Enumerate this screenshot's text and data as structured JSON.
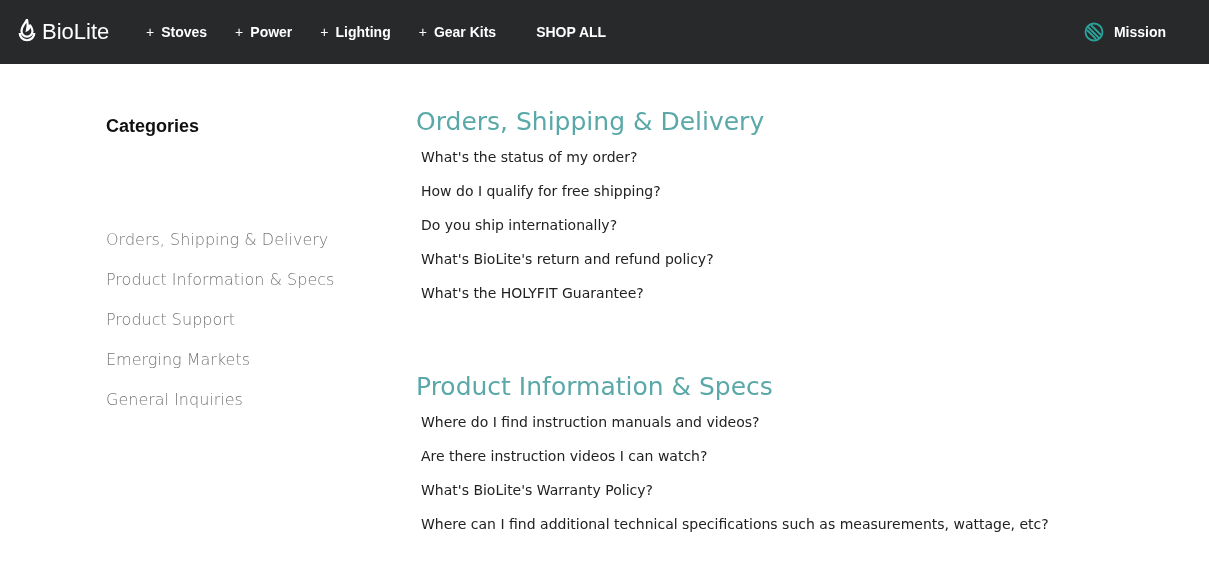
{
  "header": {
    "logo": "BioLite",
    "nav": [
      {
        "prefix": "+",
        "label": "Stoves"
      },
      {
        "prefix": "+",
        "label": "Power"
      },
      {
        "prefix": "+",
        "label": "Lighting"
      },
      {
        "prefix": "+",
        "label": "Gear Kits"
      },
      {
        "label": "SHOP ALL"
      }
    ],
    "mission": "Mission"
  },
  "sidebar": {
    "title": "Categories",
    "items": [
      "Orders, Shipping & Delivery",
      "Product Information & Specs",
      "Product Support",
      "Emerging Markets",
      "General Inquiries"
    ]
  },
  "sections": [
    {
      "title": "Orders, Shipping & Delivery",
      "questions": [
        "What's the status of my order?",
        "How do I qualify for free shipping?",
        "Do you ship internationally?",
        "What's BioLite's return and refund policy?",
        "What's the HOLYFIT Guarantee?"
      ]
    },
    {
      "title": "Product Information & Specs",
      "questions": [
        "Where do I find instruction manuals and videos?",
        "Are there instruction videos I can watch?",
        "What's BioLite's Warranty Policy?",
        "Where can I find additional technical specifications such as measurements, wattage, etc?"
      ]
    }
  ]
}
